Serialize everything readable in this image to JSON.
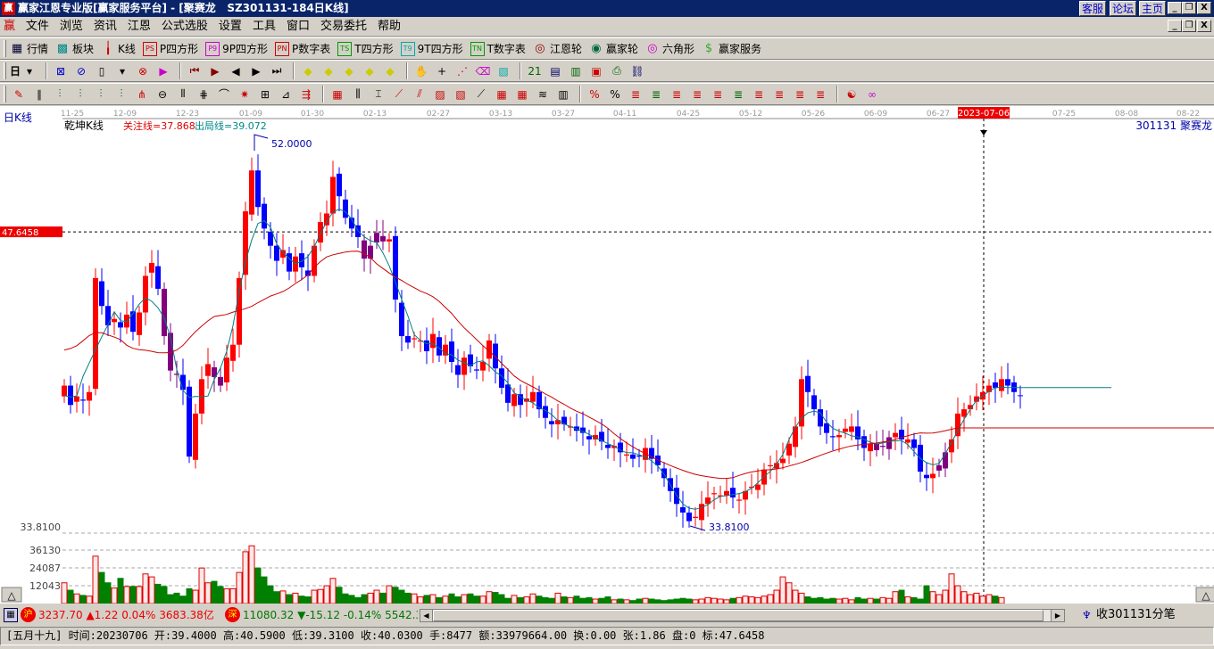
{
  "window": {
    "logo": "赢",
    "title": "赢家江恩专业版[赢家服务平台] - [聚赛龙   SZ301131-184日K线]",
    "links": [
      "客服",
      "论坛",
      "主页"
    ]
  },
  "menu": [
    "文件",
    "浏览",
    "资讯",
    "江恩",
    "公式选股",
    "设置",
    "工具",
    "窗口",
    "交易委托",
    "帮助"
  ],
  "toolbar1": [
    {
      "icon": "grid-icon",
      "glyph": "▦",
      "color": "#003",
      "label": "行情"
    },
    {
      "icon": "blocks-icon",
      "glyph": "▩",
      "color": "#088",
      "label": "板块"
    },
    {
      "icon": "kline-icon",
      "glyph": "╽",
      "color": "#c00",
      "label": "K线"
    },
    {
      "icon": "ps-icon",
      "glyph": "PS",
      "color": "#c00",
      "label": "P四方形"
    },
    {
      "icon": "p9-icon",
      "glyph": "P9",
      "color": "#c0c",
      "label": "9P四方形"
    },
    {
      "icon": "pn-icon",
      "glyph": "PN",
      "color": "#c00",
      "label": "P数字表"
    },
    {
      "icon": "ts-icon",
      "glyph": "TS",
      "color": "#090",
      "label": "T四方形"
    },
    {
      "icon": "t9-icon",
      "glyph": "T9",
      "color": "#0aa",
      "label": "9T四方形"
    },
    {
      "icon": "tn-icon",
      "glyph": "TN",
      "color": "#090",
      "label": "T数字表"
    },
    {
      "icon": "gann-wheel-icon",
      "glyph": "◎",
      "color": "#800",
      "label": "江恩轮"
    },
    {
      "icon": "winner-wheel-icon",
      "glyph": "◉",
      "color": "#064",
      "label": "赢家轮"
    },
    {
      "icon": "hexagon-icon",
      "glyph": "◎",
      "color": "#c0c",
      "label": "六角形"
    },
    {
      "icon": "dollar-icon",
      "glyph": "$",
      "color": "#3a3",
      "label": "赢家服务"
    }
  ],
  "toolbar2": {
    "period": "日",
    "icons": [
      [
        "period-dropdown-icon",
        "▾",
        "#000"
      ],
      [
        "chart-icon",
        "⊠",
        "#00c"
      ],
      [
        "zoom-icon",
        "⊘",
        "#00c"
      ],
      [
        "candle-icon",
        "▯",
        "#000"
      ],
      [
        "dropdown-icon",
        "▾",
        "#000"
      ],
      [
        "scale-icon",
        "⊗",
        "#c00"
      ],
      [
        "flag-icon",
        "▶",
        "#c0c"
      ],
      [
        "first-icon",
        "⏮",
        "#800"
      ],
      [
        "play-icon",
        "▶",
        "#800"
      ],
      [
        "prev-icon",
        "◀",
        "#000"
      ],
      [
        "next-icon",
        "▶",
        "#000"
      ],
      [
        "last-icon",
        "⏭",
        "#000"
      ],
      [
        "diamond-1-icon",
        "◆",
        "#cc0"
      ],
      [
        "diamond-2-icon",
        "◆",
        "#cc0"
      ],
      [
        "diamond-3-icon",
        "◆",
        "#cc0"
      ],
      [
        "diamond-4-icon",
        "◆",
        "#cc0"
      ],
      [
        "diamond-5-icon",
        "◆",
        "#cc0"
      ],
      [
        "hand-icon",
        "✋",
        "#000"
      ],
      [
        "crosshair-icon",
        "+",
        "#000"
      ],
      [
        "line-icon",
        "⋰",
        "#c00"
      ],
      [
        "erase-icon",
        "⌫",
        "#c0c"
      ],
      [
        "pattern-icon",
        "▧",
        "#0aa"
      ],
      [
        "num-21-icon",
        "21",
        "#060"
      ],
      [
        "calc-icon",
        "▤",
        "#006"
      ],
      [
        "table-icon",
        "▥",
        "#060"
      ],
      [
        "save-icon",
        "▣",
        "#c00"
      ],
      [
        "print-icon",
        "⎙",
        "#060"
      ],
      [
        "network-icon",
        "⛓",
        "#006"
      ]
    ]
  },
  "toolbar3": {
    "icons": [
      [
        "pen-icon",
        "✎",
        "#c00"
      ],
      [
        "parallel-icon",
        "∥",
        "#000"
      ],
      [
        "fan-1-icon",
        "⫶",
        "#060"
      ],
      [
        "fan-2-icon",
        "⫶",
        "#060"
      ],
      [
        "fan-3-icon",
        "⫶",
        "#060"
      ],
      [
        "fan-4-icon",
        "⫶",
        "#060"
      ],
      [
        "fib-icon",
        "⋔",
        "#c00"
      ],
      [
        "circle-icon",
        "⊖",
        "#000"
      ],
      [
        "bars-icon",
        "⦀",
        "#000"
      ],
      [
        "grid2-icon",
        "⋕",
        "#000"
      ],
      [
        "arc-icon",
        "⌒",
        "#000"
      ],
      [
        "wheel-icon",
        "✷",
        "#c00"
      ],
      [
        "square-icon",
        "⊞",
        "#000"
      ],
      [
        "angle-icon",
        "⊿",
        "#000"
      ],
      [
        "arrows-icon",
        "⇶",
        "#c00"
      ],
      [
        "box-icon",
        "▦",
        "#c00"
      ],
      [
        "cycle-icon",
        "⫼",
        "#000"
      ],
      [
        "column-icon",
        "⌶",
        "#000"
      ],
      [
        "trend-icon",
        "⟋",
        "#c00"
      ],
      [
        "channel-icon",
        "⫽",
        "#c00"
      ],
      [
        "square2-icon",
        "▨",
        "#c00"
      ],
      [
        "square3-icon",
        "▧",
        "#c00"
      ],
      [
        "speed-icon",
        "⟋",
        "#000"
      ],
      [
        "grid3-icon",
        "▦",
        "#c00"
      ],
      [
        "grid4-icon",
        "▦",
        "#c00"
      ],
      [
        "lines-icon",
        "≋",
        "#000"
      ],
      [
        "ruler-icon",
        "▥",
        "#000"
      ],
      [
        "percent-line-icon",
        "%",
        "#c00"
      ],
      [
        "percent-icon",
        "%",
        "#000"
      ],
      [
        "gann-line-1-icon",
        "≣",
        "#c00"
      ],
      [
        "gann-line-2-icon",
        "≣",
        "#060"
      ],
      [
        "gann-line-3-icon",
        "≣",
        "#c00"
      ],
      [
        "gann-line-4-icon",
        "≣",
        "#c00"
      ],
      [
        "gann-line-5-icon",
        "≣",
        "#c00"
      ],
      [
        "gann-line-6-icon",
        "≣",
        "#060"
      ],
      [
        "gann-line-7-icon",
        "≣",
        "#c00"
      ],
      [
        "gann-line-8-icon",
        "≣",
        "#c00"
      ],
      [
        "gann-line-9-icon",
        "≣",
        "#c00"
      ],
      [
        "gann-line-10-icon",
        "≣",
        "#c00"
      ],
      [
        "yinyang-icon",
        "☯",
        "#c00"
      ],
      [
        "infinity-icon",
        "∞",
        "#c0c"
      ]
    ]
  },
  "chart": {
    "period_label": "日K线",
    "indicator": "乾坤K线",
    "focus_line": "关注线=37.868",
    "exit_line": "出局线=39.072",
    "code_name": "301131  聚赛龙",
    "high_label": "52.0000",
    "low_label": "33.8100",
    "cursor_price": "47.6458",
    "cursor_date": "2023-07-06",
    "low_axis_label": "33.8100",
    "dates": [
      "11-25",
      "12-09",
      "12-23",
      "01-09",
      "01-30",
      "02-13",
      "02-27",
      "03-13",
      "03-27",
      "04-11",
      "04-25",
      "05-12",
      "05-26",
      "06-09",
      "06-27",
      "2023-07-06",
      "07-25",
      "08-08",
      "08-22"
    ],
    "vol_ticks": [
      "36130",
      "24087",
      "12043"
    ],
    "expand_button": "△",
    "colors": {
      "up": "#ff0000",
      "down": "#0000ff",
      "neutral": "#800080",
      "ma_fast": "#008080",
      "ma_slow": "#cc0000"
    }
  },
  "chart_data": {
    "type": "candlestick",
    "price_range": [
      33.81,
      52.0
    ],
    "cursor_price": 47.6458,
    "closes": [
      40.5,
      39.6,
      40.0,
      39.8,
      40.2,
      45.5,
      44.2,
      43.3,
      43.6,
      43.2,
      43.8,
      43.0,
      43.9,
      45.6,
      46.2,
      45.0,
      42.8,
      41.2,
      41.0,
      40.3,
      37.2,
      39.2,
      40.8,
      41.5,
      40.9,
      40.5,
      41.8,
      42.4,
      45.5,
      48.6,
      50.5,
      48.8,
      47.8,
      47.0,
      46.3,
      46.8,
      45.8,
      46.5,
      46.0,
      45.6,
      47.0,
      48.1,
      48.5,
      50.2,
      49.3,
      48.3,
      47.8,
      47.4,
      46.4,
      47.0,
      47.6,
      47.2,
      47.3,
      44.5,
      42.8,
      42.5,
      42.7,
      42.6,
      42.1,
      42.9,
      41.9,
      42.4,
      41.6,
      41.0,
      41.8,
      41.4,
      41.2,
      41.6,
      42.6,
      41.3,
      40.4,
      39.7,
      40.1,
      39.6,
      39.9,
      40.2,
      39.4,
      39.0,
      38.7,
      38.9,
      38.7,
      38.6,
      38.4,
      38.3,
      38.0,
      38.2,
      37.9,
      37.6,
      37.7,
      37.4,
      37.3,
      37.1,
      37.2,
      37.6,
      37.1,
      36.8,
      36.2,
      35.6,
      35.0,
      34.6,
      34.2,
      34.4,
      35.0,
      35.3,
      35.5,
      35.4,
      35.6,
      35.3,
      35.2,
      35.6,
      35.8,
      35.9,
      36.6,
      36.8,
      36.9,
      37.1,
      37.8,
      38.6,
      40.8,
      40.2,
      39.4,
      38.6,
      38.3,
      38.1,
      38.2,
      38.5,
      38.6,
      38.0,
      37.6,
      37.8,
      37.5,
      37.7,
      38.1,
      38.3,
      38.0,
      38.0,
      37.6,
      36.5,
      36.2,
      36.4,
      36.8,
      37.4,
      38.0,
      39.2,
      39.4,
      39.6,
      40.0,
      40.2,
      40.5,
      40.4,
      40.8,
      40.5,
      40.2,
      40.03
    ],
    "volumes": [
      14000,
      9000,
      6500,
      5500,
      5000,
      32000,
      21000,
      14000,
      10500,
      17000,
      11500,
      11500,
      11500,
      20000,
      18000,
      13000,
      11500,
      6000,
      7000,
      5000,
      10000,
      9000,
      24000,
      14000,
      15000,
      11500,
      10000,
      10000,
      21000,
      35000,
      39000,
      24000,
      18000,
      12000,
      8000,
      8500,
      6000,
      7000,
      5000,
      4500,
      9000,
      9500,
      12000,
      17000,
      11000,
      6500,
      5500,
      4000,
      6000,
      7000,
      9000,
      7000,
      12000,
      11000,
      9000,
      7000,
      6500,
      4500,
      5500,
      6000,
      4000,
      5000,
      6500,
      4500,
      6000,
      6500,
      5000,
      5000,
      8000,
      7500,
      6000,
      3500,
      5500,
      4000,
      4500,
      6500,
      5000,
      4000,
      3500,
      7000,
      4500,
      4000,
      5000,
      3500,
      4000,
      3000,
      3500,
      4500,
      2500,
      3000,
      2500,
      2000,
      3000,
      3500,
      3000,
      2500,
      2000,
      2500,
      3000,
      3500,
      3000,
      2500,
      3000,
      4000,
      3500,
      3000,
      2500,
      3500,
      4000,
      5000,
      4500,
      4000,
      5000,
      6000,
      9000,
      18000,
      14000,
      9000,
      7000,
      4500,
      3500,
      4000,
      3000,
      3500,
      3000,
      3500,
      2500,
      4000,
      3000,
      3500,
      3000,
      4000,
      3500,
      8000,
      9000,
      4500,
      4000,
      3000,
      12000,
      8000,
      6000,
      9000,
      20000,
      12000,
      8000,
      6000,
      7000,
      5000,
      6000,
      5000,
      4000
    ],
    "neutral_indices": [
      16,
      17,
      18,
      24,
      25,
      48,
      49,
      50,
      51,
      130,
      131,
      132,
      140,
      141
    ],
    "vol_ticks": [
      12043,
      24087,
      36130
    ]
  },
  "index_bar": {
    "sh_icon": "沪",
    "sh": "3237.70",
    "sh_chg": "▲1.22",
    "sh_pct": "0.04%",
    "sh_amt": "3683.38亿",
    "sz_icon": "深",
    "sz": "11080.32",
    "sz_chg": "▼-15.12",
    "sz_pct": "-0.14%",
    "sz_amt": "5542.3",
    "ticker": "收301131分笔"
  },
  "status": "[五月十九] 时间:20230706 开:39.4000 高:40.5900 低:39.3100 收:40.0300 手:8477 额:33979664.00 换:0.00 张:1.86 盘:0 标:47.6458"
}
